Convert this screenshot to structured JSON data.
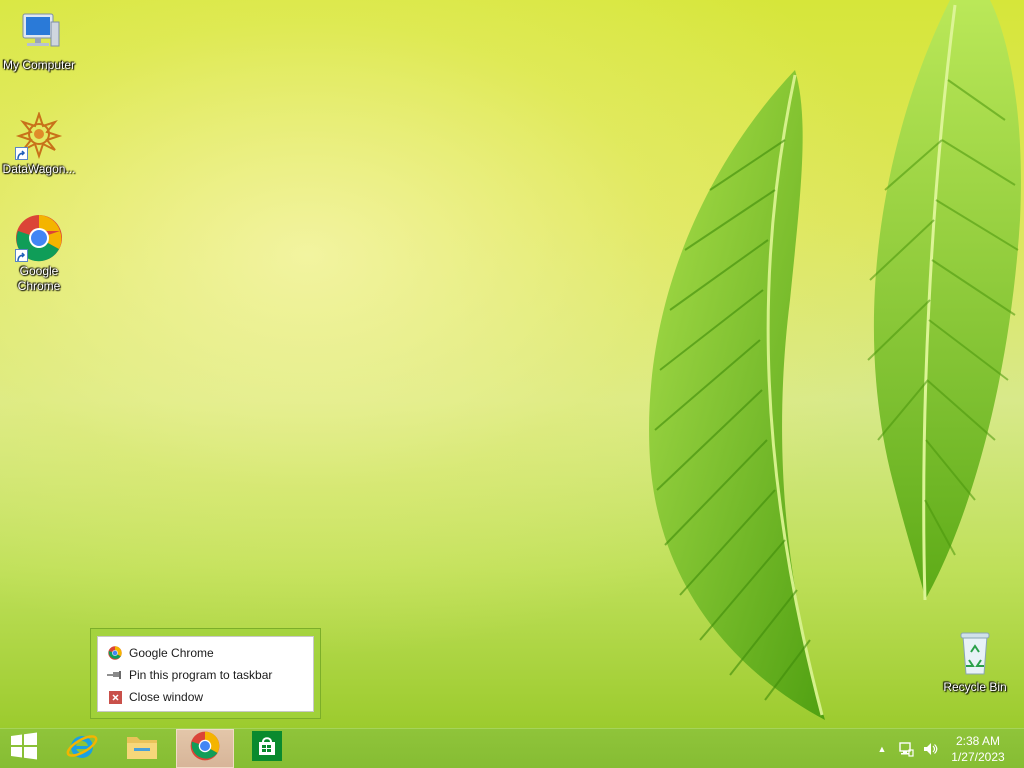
{
  "desktop": {
    "icons": [
      {
        "label": "My Computer",
        "icon": "computer-icon"
      },
      {
        "label": "DataWagon...",
        "icon": "datawagon-icon"
      },
      {
        "label": "Google\nChrome",
        "icon": "chrome-icon"
      },
      {
        "label": "Recycle Bin",
        "icon": "recycle-bin-icon"
      }
    ]
  },
  "jumplist": {
    "items": [
      {
        "label": "Google Chrome",
        "icon": "chrome-icon"
      },
      {
        "label": "Pin this program to taskbar",
        "icon": "pin-icon"
      },
      {
        "label": "Close window",
        "icon": "close-icon"
      }
    ]
  },
  "taskbar": {
    "buttons": [
      {
        "name": "start",
        "icon": "windows-logo-icon"
      },
      {
        "name": "internet-explorer",
        "icon": "ie-icon"
      },
      {
        "name": "file-explorer",
        "icon": "folder-icon"
      },
      {
        "name": "google-chrome",
        "icon": "chrome-icon",
        "active": true
      },
      {
        "name": "store",
        "icon": "store-icon"
      }
    ],
    "tray": {
      "show_hidden": "▲",
      "time": "2:38 AM",
      "date": "1/27/2023"
    }
  },
  "colors": {
    "taskbar": "#8fc43a",
    "accent": "#86bd33"
  }
}
